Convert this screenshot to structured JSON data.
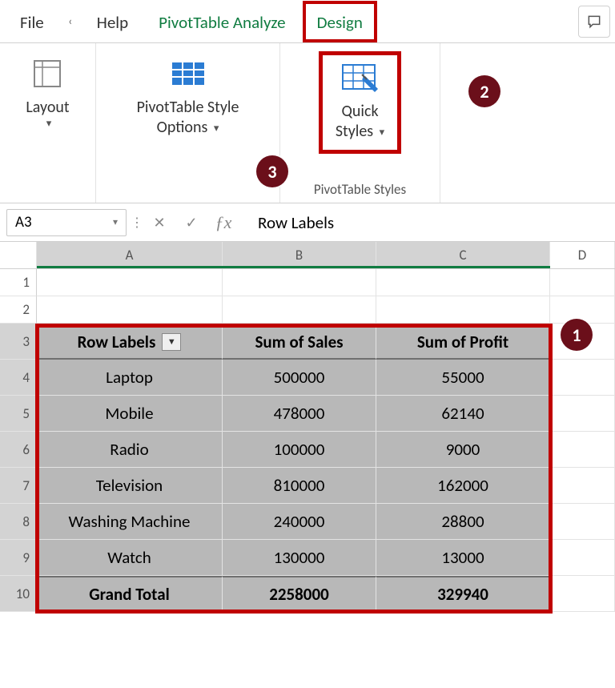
{
  "tabs": {
    "file": "File",
    "help": "Help",
    "analyze": "PivotTable Analyze",
    "design": "Design"
  },
  "ribbon": {
    "layout_label": "Layout",
    "styleopts_line1": "PivotTable Style",
    "styleopts_line2": "Options",
    "quickstyles_line1": "Quick",
    "quickstyles_line2": "Styles",
    "group_styles_label": "PivotTable Styles"
  },
  "badges": {
    "b1": "1",
    "b2": "2",
    "b3": "3"
  },
  "formula_bar": {
    "name_box": "A3",
    "content": "Row Labels"
  },
  "columns": {
    "A": "A",
    "B": "B",
    "C": "C",
    "D": "D"
  },
  "row_nums": [
    "1",
    "2",
    "3",
    "4",
    "5",
    "6",
    "7",
    "8",
    "9",
    "10"
  ],
  "pivot": {
    "headers": {
      "row_labels": "Row Labels",
      "sum_sales": "Sum of Sales",
      "sum_profit": "Sum of Profit"
    },
    "rows": [
      {
        "label": "Laptop",
        "sales": "500000",
        "profit": "55000"
      },
      {
        "label": "Mobile",
        "sales": "478000",
        "profit": "62140"
      },
      {
        "label": "Radio",
        "sales": "100000",
        "profit": "9000"
      },
      {
        "label": "Television",
        "sales": "810000",
        "profit": "162000"
      },
      {
        "label": "Washing Machine",
        "sales": "240000",
        "profit": "28800"
      },
      {
        "label": "Watch",
        "sales": "130000",
        "profit": "13000"
      }
    ],
    "total": {
      "label": "Grand Total",
      "sales": "2258000",
      "profit": "329940"
    }
  }
}
